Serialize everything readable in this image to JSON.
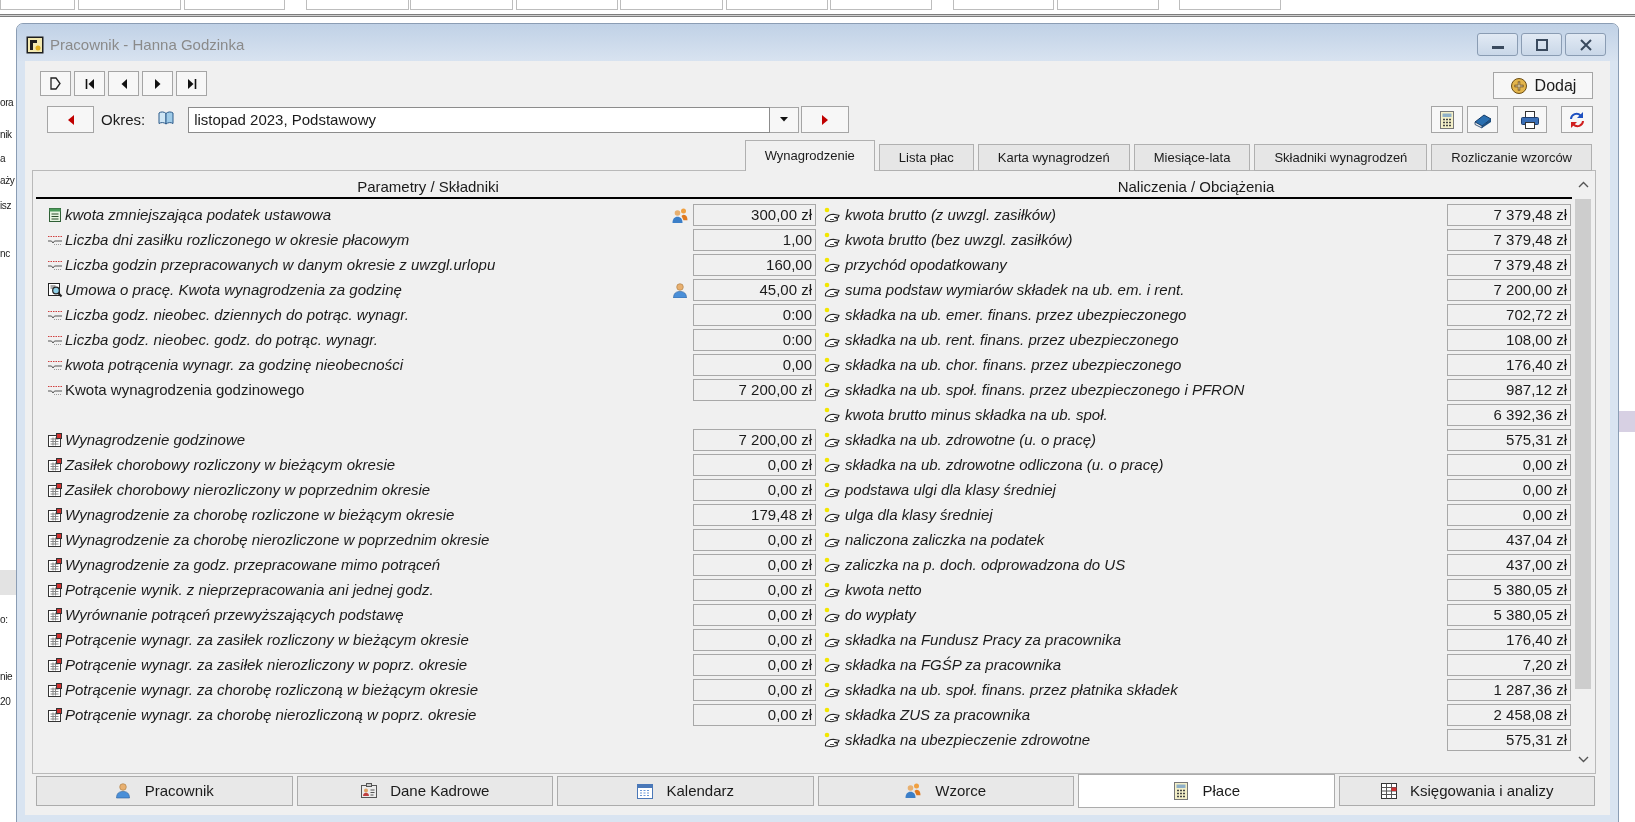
{
  "window": {
    "title": "Pracownik - Hanna Godzinka"
  },
  "background_window": {
    "upper_fragments": [
      "ora",
      "nik",
      "a",
      "aży",
      "isz",
      "nc"
    ],
    "lower_fragments": [
      "o:",
      "nie",
      "20"
    ]
  },
  "toolbar": {
    "add_button": "Dodaj"
  },
  "period": {
    "label": "Okres:",
    "value": "listopad 2023, Podstawowy"
  },
  "tabs": [
    {
      "label": "Wynagrodzenie",
      "selected": true
    },
    {
      "label": "Lista płac",
      "selected": false
    },
    {
      "label": "Karta wynagrodzeń",
      "selected": false
    },
    {
      "label": "Miesiące-lata",
      "selected": false
    },
    {
      "label": "Składniki wynagrodzeń",
      "selected": false
    },
    {
      "label": "Rozliczanie wzorców",
      "selected": false
    }
  ],
  "left_column": {
    "heading": "Parametry / Składniki",
    "groups": [
      {
        "rows": [
          {
            "kind": "note",
            "label": "kwota zmniejszająca podatek ustawowa",
            "value": "300,00 zł",
            "italic": true,
            "template_linked": true,
            "employee_linked": false
          },
          {
            "kind": "parameter",
            "label": "Liczba dni zasiłku rozliczonego w okresie płacowym",
            "value": "1,00",
            "italic": true,
            "template_linked": false,
            "employee_linked": false
          },
          {
            "kind": "parameter",
            "label": "Liczba godzin przepracowanych w danym okresie z uwzgl.urlopu",
            "value": "160,00",
            "italic": true,
            "template_linked": false,
            "employee_linked": false
          },
          {
            "kind": "contract",
            "label": "Umowa o pracę. Kwota wynagrodzenia za godzinę",
            "value": "45,00 zł",
            "italic": true,
            "template_linked": false,
            "employee_linked": true
          },
          {
            "kind": "parameter",
            "label": "Liczba godz. nieobec. dziennych do potrąc. wynagr.",
            "value": "0:00",
            "italic": true,
            "template_linked": false,
            "employee_linked": false
          },
          {
            "kind": "parameter",
            "label": "Liczba godz. nieobec. godz. do potrąc. wynagr.",
            "value": "0:00",
            "italic": true,
            "template_linked": false,
            "employee_linked": false
          },
          {
            "kind": "parameter",
            "label": "kwota potrącenia wynagr. za godzinę nieobecności",
            "value": "0,00",
            "italic": true,
            "template_linked": false,
            "employee_linked": false
          },
          {
            "kind": "parameter",
            "label": "Kwota wynagrodzenia godzinowego",
            "value": "7 200,00 zł",
            "italic": false,
            "template_linked": false,
            "employee_linked": false
          }
        ]
      },
      {
        "rows": [
          {
            "kind": "component",
            "label": "Wynagrodzenie godzinowe",
            "value": "7 200,00 zł",
            "italic": true
          },
          {
            "kind": "component",
            "label": "Zasiłek chorobowy rozliczony w bieżącym okresie",
            "value": "0,00 zł",
            "italic": true
          },
          {
            "kind": "component",
            "label": "Zasiłek chorobowy nierozliczony w poprzednim okresie",
            "value": "0,00 zł",
            "italic": true
          },
          {
            "kind": "component",
            "label": "Wynagrodzenie za chorobę rozliczone w bieżącym okresie",
            "value": "179,48 zł",
            "italic": true
          },
          {
            "kind": "component",
            "label": "Wynagrodzenie za chorobę nierozliczone w poprzednim okresie",
            "value": "0,00 zł",
            "italic": true
          },
          {
            "kind": "component",
            "label": "Wynagrodzenie za godz. przepracowane mimo potrąceń",
            "value": "0,00 zł",
            "italic": true
          },
          {
            "kind": "component",
            "label": "Potrącenie wynik. z nieprzepracowania ani jednej godz.",
            "value": "0,00 zł",
            "italic": true
          },
          {
            "kind": "component",
            "label": "Wyrównanie potrąceń przewyższających podstawę",
            "value": "0,00 zł",
            "italic": true
          },
          {
            "kind": "component",
            "label": "Potrącenie wynagr. za zasiłek rozliczony w bieżącym okresie",
            "value": "0,00 zł",
            "italic": true
          },
          {
            "kind": "component",
            "label": "Potrącenie wynagr. za zasiłek nierozliczony w poprz. okresie",
            "value": "0,00 zł",
            "italic": true
          },
          {
            "kind": "component",
            "label": "Potrącenie wynagr. za chorobę rozliczoną w bieżącym okresie",
            "value": "0,00 zł",
            "italic": true
          },
          {
            "kind": "component",
            "label": "Potrącenie wynagr. za chorobę nierozliczoną w poprz. okresie",
            "value": "0,00 zł",
            "italic": true
          }
        ]
      }
    ]
  },
  "right_column": {
    "heading": "Naliczenia / Obciążenia",
    "rows": [
      {
        "label": "kwota brutto (z uwzgl. zasiłków)",
        "value": "7 379,48 zł"
      },
      {
        "label": "kwota brutto (bez uwzgl. zasiłków)",
        "value": "7 379,48 zł"
      },
      {
        "label": "przychód opodatkowany",
        "value": "7 379,48 zł"
      },
      {
        "label": "suma podstaw wymiarów składek na ub. em. i rent.",
        "value": "7 200,00 zł"
      },
      {
        "label": "składka na ub. emer. finans. przez ubezpieczonego",
        "value": "702,72 zł"
      },
      {
        "label": "składka na ub. rent. finans. przez ubezpieczonego",
        "value": "108,00 zł"
      },
      {
        "label": "składka na ub. chor. finans. przez ubezpieczonego",
        "value": "176,40 zł"
      },
      {
        "label": "składka na ub. społ. finans. przez ubezpieczonego i PFRON",
        "value": "987,12 zł"
      },
      {
        "label": "kwota brutto minus składka na ub. społ.",
        "value": "6 392,36 zł"
      },
      {
        "label": "składka na ub. zdrowotne (u. o pracę)",
        "value": "575,31 zł"
      },
      {
        "label": "składka na ub. zdrowotne odliczona (u. o pracę)",
        "value": "0,00 zł"
      },
      {
        "label": "podstawa ulgi dla klasy średniej",
        "value": "0,00 zł"
      },
      {
        "label": "ulga dla klasy średniej",
        "value": "0,00 zł"
      },
      {
        "label": "naliczona zaliczka na podatek",
        "value": "437,04 zł"
      },
      {
        "label": "zaliczka na p. doch. odprowadzona do US",
        "value": "437,00 zł"
      },
      {
        "label": "kwota netto",
        "value": "5 380,05 zł"
      },
      {
        "label": "do wypłaty",
        "value": "5 380,05 zł"
      },
      {
        "label": "składka na Fundusz Pracy za pracownika",
        "value": "176,40 zł"
      },
      {
        "label": "składka na FGŚP za pracownika",
        "value": "7,20 zł"
      },
      {
        "label": "składka na ub. społ. finans. przez płatnika składek",
        "value": "1 287,36 zł"
      },
      {
        "label": "składka ZUS za pracownika",
        "value": "2 458,08 zł"
      },
      {
        "label": "składka na ubezpieczenie zdrowotne",
        "value": "575,31 zł"
      }
    ]
  },
  "bottom_tabs": [
    {
      "label": "Pracownik",
      "selected": false
    },
    {
      "label": "Dane Kadrowe",
      "selected": false
    },
    {
      "label": "Kalendarz",
      "selected": false
    },
    {
      "label": "Wzorce",
      "selected": false
    },
    {
      "label": "Płace",
      "selected": true
    },
    {
      "label": "Księgowania i analizy",
      "selected": false
    }
  ]
}
